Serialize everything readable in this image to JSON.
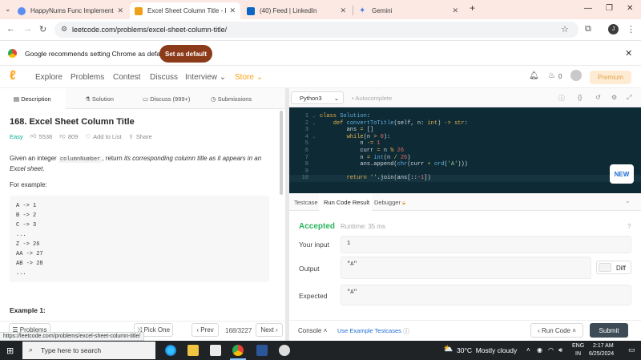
{
  "browser": {
    "tabs": [
      {
        "title": "HappyNums Func Implemented",
        "favicon_color": "#5b8def"
      },
      {
        "title": "Excel Sheet Column Title - Leetc",
        "favicon_color": "#f0a018",
        "active": true
      },
      {
        "title": "(40) Feed | LinkedIn",
        "favicon_color": "#0a66c2"
      },
      {
        "title": "Gemini",
        "favicon_color": "#4b7bec"
      }
    ],
    "url": "leetcode.com/problems/excel-sheet-column-title/",
    "profile_initial": "J",
    "infobar_text": "Google recommends setting Chrome as default",
    "set_default_label": "Set as default",
    "status_url": "https://leetcode.com/problems/excel-sheet-column-title/"
  },
  "leetcode_nav": {
    "links": [
      "Explore",
      "Problems",
      "Contest",
      "Discuss",
      "Interview",
      "Store"
    ],
    "coins": "0",
    "premium_label": "Premium"
  },
  "left_tabs": [
    "Description",
    "Solution",
    "Discuss (999+)",
    "Submissions"
  ],
  "problem": {
    "title": "168. Excel Sheet Column Title",
    "difficulty": "Easy",
    "likes": "5538",
    "dislikes": "809",
    "add_to_list": "Add to List",
    "share": "Share",
    "desc_pre": "Given an integer ",
    "desc_code": "columnNumber",
    "desc_mid": ", return ",
    "desc_em": "its corresponding column title as it appears in an Excel sheet",
    "desc_end": ".",
    "for_example": "For example:",
    "example_lines": [
      "A -> 1",
      "B -> 2",
      "C -> 3",
      "...",
      "Z -> 26",
      "AA -> 27",
      "AB -> 28",
      "..."
    ],
    "example1_heading": "Example 1:"
  },
  "left_bottom": {
    "problems_label": "Problems",
    "pick_one_label": "Pick One",
    "prev_label": "Prev",
    "counter": "168/3227",
    "next_label": "Next"
  },
  "editor": {
    "language": "Python3",
    "autocomplete": "Autocomplete",
    "new_label": "NEW"
  },
  "result_tabs": [
    "Testcase",
    "Run Code Result",
    "Debugger"
  ],
  "result": {
    "status": "Accepted",
    "runtime": "Runtime: 35 ms",
    "input_label": "Your input",
    "input_value": "1",
    "output_label": "Output",
    "output_value": "\"A\"",
    "diff_label": "Diff",
    "expected_label": "Expected",
    "expected_value": "\"A\""
  },
  "right_bottom": {
    "console_label": "Console",
    "example_testcases": "Use Example Testcases",
    "run_code_label": "Run Code",
    "submit_label": "Submit"
  },
  "taskbar": {
    "search_placeholder": "Type here to search",
    "weather": "30°C  Mostly cloudy",
    "lang": "ENG",
    "region": "IN",
    "time": "2:17 AM",
    "date": "6/25/2024"
  },
  "colors": {
    "accent_orange": "#ffa116",
    "accepted_green": "#2db55d",
    "easy_green": "#00af9b",
    "editor_bg": "#0e2a35",
    "submit_bg": "#3c4b55"
  }
}
